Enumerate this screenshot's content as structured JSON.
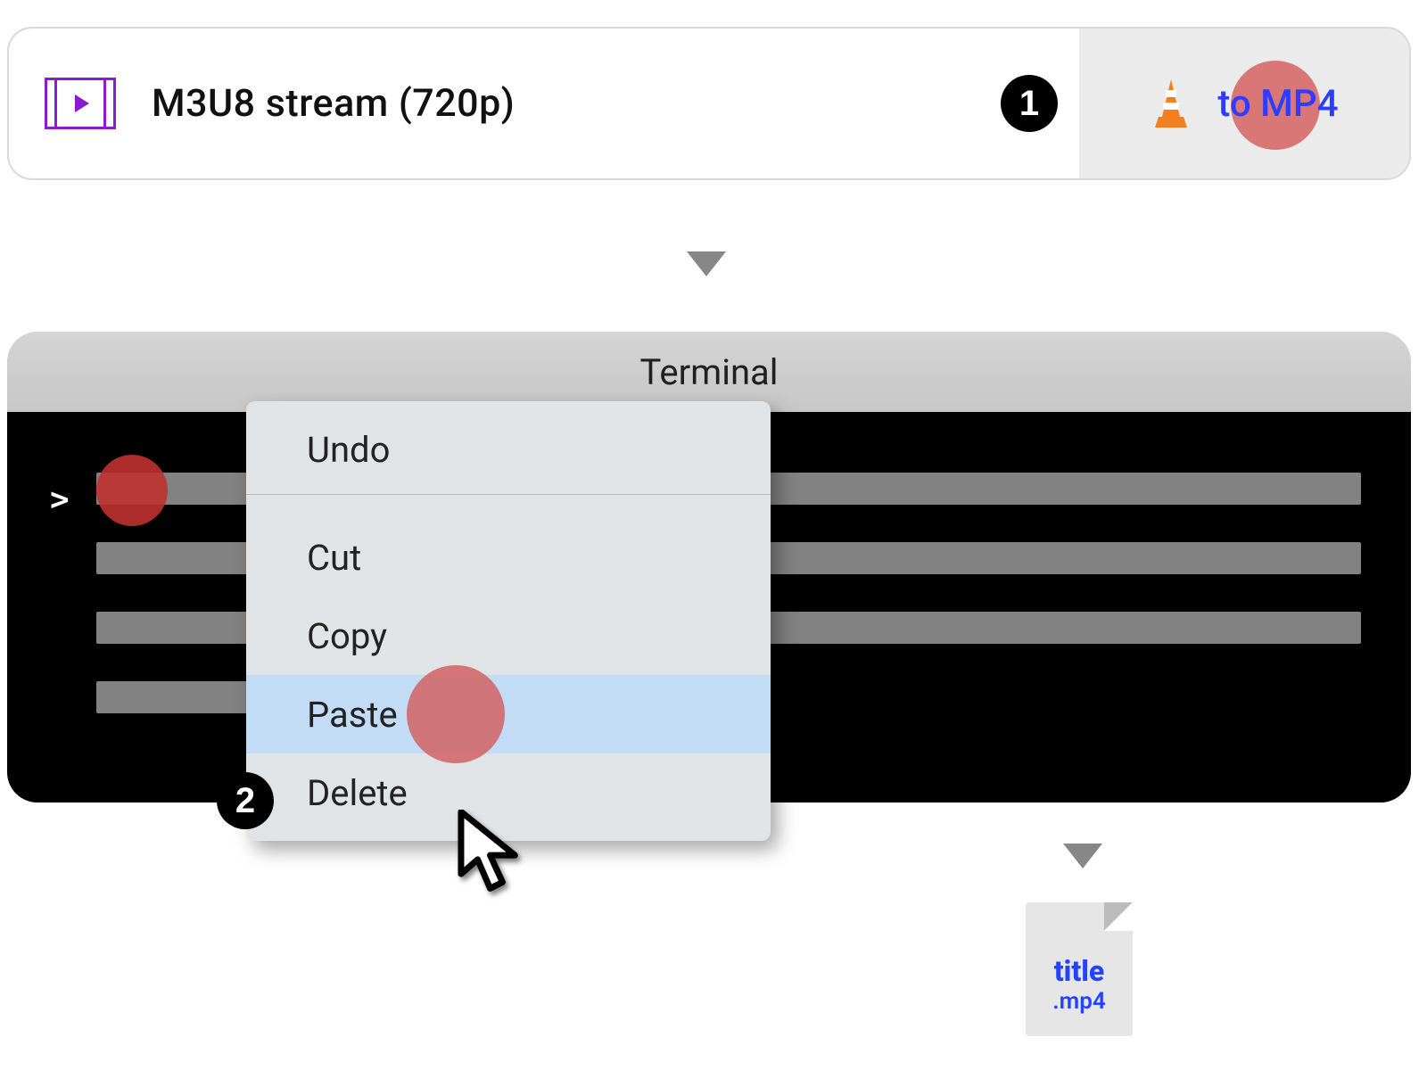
{
  "search": {
    "label": "M3U8 stream (720p)",
    "icon_name": "video-stream-icon",
    "result": {
      "app_icon": "vlc-cone-icon",
      "text": "to MP4"
    }
  },
  "steps": {
    "one": "1",
    "two": "2"
  },
  "terminal": {
    "title": "Terminal",
    "prompt": ">"
  },
  "context_menu": {
    "items": [
      "Undo",
      "Cut",
      "Copy",
      "Paste",
      "Delete"
    ],
    "highlighted_index": 3
  },
  "output_file": {
    "title": "title",
    "ext": ".mp4"
  }
}
